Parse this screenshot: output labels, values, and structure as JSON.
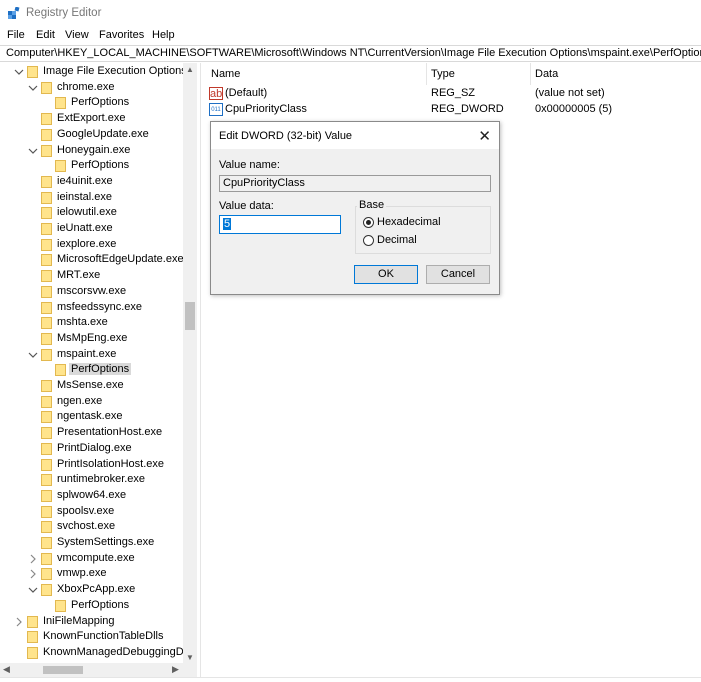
{
  "window": {
    "title": "Registry Editor",
    "icon": "registry-icon"
  },
  "menu": [
    "File",
    "Edit",
    "View",
    "Favorites",
    "Help"
  ],
  "address": "Computer\\HKEY_LOCAL_MACHINE\\SOFTWARE\\Microsoft\\Windows NT\\CurrentVersion\\Image File Execution Options\\mspaint.exe\\PerfOptions",
  "tree": [
    {
      "label": "Image File Execution Options",
      "expander": "expanded"
    },
    {
      "label": "chrome.exe",
      "expander": "expanded"
    },
    {
      "label": "PerfOptions",
      "expander": "none"
    },
    {
      "label": "ExtExport.exe",
      "expander": "none"
    },
    {
      "label": "GoogleUpdate.exe",
      "expander": "none"
    },
    {
      "label": "Honeygain.exe",
      "expander": "expanded"
    },
    {
      "label": "PerfOptions",
      "expander": "none"
    },
    {
      "label": "ie4uinit.exe",
      "expander": "none"
    },
    {
      "label": "ieinstal.exe",
      "expander": "none"
    },
    {
      "label": "ielowutil.exe",
      "expander": "none"
    },
    {
      "label": "ieUnatt.exe",
      "expander": "none"
    },
    {
      "label": "iexplore.exe",
      "expander": "none"
    },
    {
      "label": "MicrosoftEdgeUpdate.exe",
      "expander": "none"
    },
    {
      "label": "MRT.exe",
      "expander": "none"
    },
    {
      "label": "mscorsvw.exe",
      "expander": "none"
    },
    {
      "label": "msfeedssync.exe",
      "expander": "none"
    },
    {
      "label": "mshta.exe",
      "expander": "none"
    },
    {
      "label": "MsMpEng.exe",
      "expander": "none"
    },
    {
      "label": "mspaint.exe",
      "expander": "expanded"
    },
    {
      "label": "PerfOptions",
      "expander": "none",
      "selected": true
    },
    {
      "label": "MsSense.exe",
      "expander": "none"
    },
    {
      "label": "ngen.exe",
      "expander": "none"
    },
    {
      "label": "ngentask.exe",
      "expander": "none"
    },
    {
      "label": "PresentationHost.exe",
      "expander": "none"
    },
    {
      "label": "PrintDialog.exe",
      "expander": "none"
    },
    {
      "label": "PrintIsolationHost.exe",
      "expander": "none"
    },
    {
      "label": "runtimebroker.exe",
      "expander": "none"
    },
    {
      "label": "splwow64.exe",
      "expander": "none"
    },
    {
      "label": "spoolsv.exe",
      "expander": "none"
    },
    {
      "label": "svchost.exe",
      "expander": "none"
    },
    {
      "label": "SystemSettings.exe",
      "expander": "none"
    },
    {
      "label": "vmcompute.exe",
      "expander": "collapsed"
    },
    {
      "label": "vmwp.exe",
      "expander": "collapsed"
    },
    {
      "label": "XboxPcApp.exe",
      "expander": "expanded"
    },
    {
      "label": "PerfOptions",
      "expander": "none"
    },
    {
      "label": "IniFileMapping",
      "expander": "collapsed"
    },
    {
      "label": "KnownFunctionTableDlls",
      "expander": "none"
    },
    {
      "label": "KnownManagedDebuggingDll",
      "expander": "none"
    }
  ],
  "list": {
    "columns": [
      "Name",
      "Type",
      "Data"
    ],
    "rows": [
      {
        "icon": "string-value-icon",
        "icon_text": "ab",
        "name": "(Default)",
        "type": "REG_SZ",
        "data": "(value not set)"
      },
      {
        "icon": "binary-value-icon",
        "icon_text": "011",
        "name": "CpuPriorityClass",
        "type": "REG_DWORD",
        "data": "0x00000005 (5)"
      }
    ]
  },
  "dialog": {
    "title": "Edit DWORD (32-bit) Value",
    "value_name_label": "Value name:",
    "value_name": "CpuPriorityClass",
    "value_data_label": "Value data:",
    "value_data": "5",
    "base_label": "Base",
    "options": [
      "Hexadecimal",
      "Decimal"
    ],
    "selected_option": "Hexadecimal",
    "ok_label": "OK",
    "cancel_label": "Cancel"
  },
  "colors": {
    "folder": "#ffe48c",
    "selection": "#0078d7",
    "tree_selected": "#d9d9d9"
  }
}
